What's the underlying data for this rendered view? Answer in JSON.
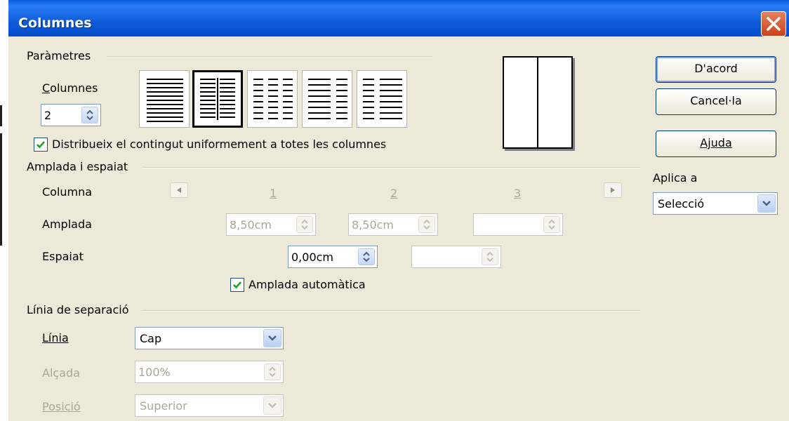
{
  "window": {
    "title": "Columnes"
  },
  "settings": {
    "group_label": "Paràmetres",
    "columns_label": "Columnes",
    "columns_value": "2",
    "distribute_label": "Distribueix el contingut uniformement a totes les columnes",
    "distribute_checked": true
  },
  "width_spacing": {
    "group_label": "Amplada i espaiat",
    "column_label": "Columna",
    "width_label": "Amplada",
    "spacing_label": "Espaiat",
    "col_numbers": [
      "1",
      "2",
      "3"
    ],
    "widths": [
      "8,50cm",
      "8,50cm",
      ""
    ],
    "spacings": [
      "0,00cm",
      ""
    ],
    "auto_width_label": "Amplada automàtica",
    "auto_width_checked": true
  },
  "separator": {
    "group_label": "Línia de separació",
    "line_label": "Línia",
    "line_value": "Cap",
    "height_label": "Alçada",
    "height_value": "100%",
    "position_label": "Posició",
    "position_value": "Superior"
  },
  "buttons": {
    "ok": "D'acord",
    "cancel": "Cancel·la",
    "help": "Ajuda"
  },
  "apply": {
    "label": "Aplica a",
    "value": "Selecció"
  },
  "colors": {
    "title_bar": "#0054e3",
    "dialog_bg": "#ece9d8",
    "close_btn": "#d9552e"
  }
}
